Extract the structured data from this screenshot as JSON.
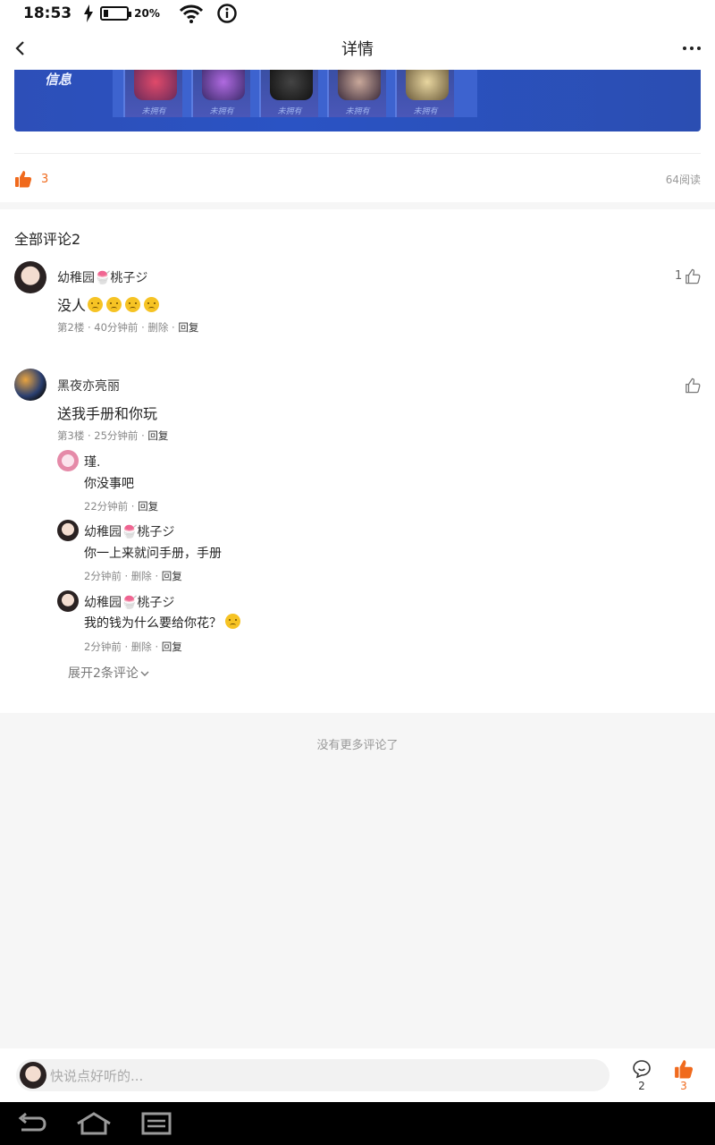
{
  "status_bar": {
    "time": "18:53",
    "battery_pct": "20%",
    "battery_level": 0.2
  },
  "nav": {
    "title": "详情"
  },
  "post": {
    "banner_label": "信息",
    "tile_captions": [
      "未拥有",
      "未拥有",
      "未拥有",
      "未拥有",
      "未拥有"
    ],
    "likes": "3",
    "reads": "64阅读"
  },
  "comments": {
    "title": "全部评论2",
    "items": [
      {
        "name": "幼稚园🍧桃子ジ",
        "text": "没人",
        "emoji_count": 4,
        "floor": "第2楼",
        "time": "40分钟前",
        "delete": "删除",
        "reply": "回复",
        "likes": "1"
      },
      {
        "name": "黑夜亦亮丽",
        "text": "送我手册和你玩",
        "floor": "第3楼",
        "time": "25分钟前",
        "reply": "回复",
        "replies": [
          {
            "name": "瑾.",
            "text": "你没事吧",
            "time": "22分钟前",
            "reply": "回复"
          },
          {
            "name": "幼稚园🍧桃子ジ",
            "text": "你一上来就问手册，手册",
            "time": "2分钟前",
            "delete": "删除",
            "reply": "回复"
          },
          {
            "name": "幼稚园🍧桃子ジ",
            "text": "我的钱为什么要给你花？",
            "time": "2分钟前",
            "delete": "删除",
            "reply": "回复"
          }
        ],
        "expand": "展开2条评论"
      }
    ],
    "no_more": "没有更多评论了"
  },
  "bottom_bar": {
    "input_placeholder": "快说点好听的...",
    "comment_count": "2",
    "like_count": "3"
  },
  "colors": {
    "accent": "#f06a1d",
    "banner": "#2d4fb8"
  }
}
